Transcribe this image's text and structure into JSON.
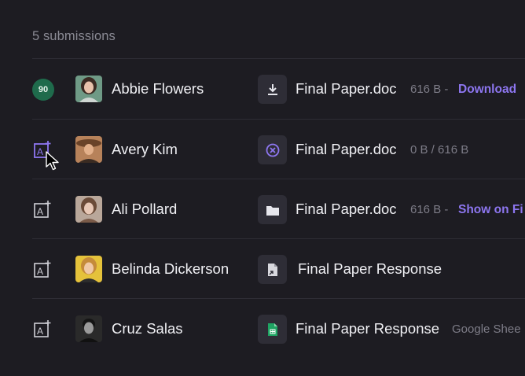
{
  "header": {
    "count_label": "5 submissions"
  },
  "colors": {
    "background": "#1d1c22",
    "accent": "#8d76f0",
    "grade_badge": "#1f6b4c",
    "sheets_green": "#1fa463"
  },
  "submissions": [
    {
      "grade": "90",
      "student": "Abbie Flowers",
      "file_icon": "download-icon",
      "file_name": "Final Paper.doc",
      "file_meta": "616 B -",
      "file_action": "Download"
    },
    {
      "grade_icon": "assign-grade-icon",
      "student": "Avery Kim",
      "file_icon": "cancel-upload-icon",
      "file_name": "Final Paper.doc",
      "file_meta": "0 B / 616 B"
    },
    {
      "grade_icon": "assign-grade-icon",
      "student": "Ali Pollard",
      "file_icon": "folder-icon",
      "file_name": "Final Paper.doc",
      "file_meta": "616 B -",
      "file_action": "Show on Fi"
    },
    {
      "grade_icon": "assign-grade-icon",
      "student": "Belinda Dickerson",
      "file_icon": "document-link-icon",
      "file_name": "Final Paper Response"
    },
    {
      "grade_icon": "assign-grade-icon",
      "student": "Cruz Salas",
      "file_icon": "google-sheets-icon",
      "file_name": "Final Paper Response",
      "file_meta": "Google Shee"
    }
  ]
}
